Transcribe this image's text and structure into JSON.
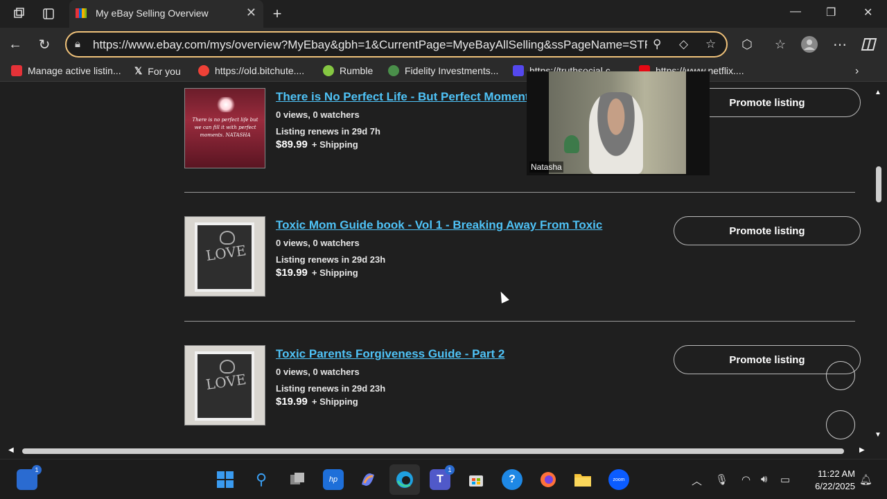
{
  "browser": {
    "tab_title": "My eBay Selling Overview",
    "url": "https://www.ebay.com/mys/overview?MyEbay&gbh=1&CurrentPage=MyeBayAllSelling&ssPageName=STRK...",
    "new_tab_label": "+"
  },
  "bookmarks": [
    {
      "label": "Manage active listin...",
      "icon": "ebay-icon",
      "color": "#e53238"
    },
    {
      "label": "For you",
      "icon": "x-icon",
      "color": "#000000"
    },
    {
      "label": "https://old.bitchute....",
      "icon": "bitchute-icon",
      "color": "#ef4137"
    },
    {
      "label": "Rumble",
      "icon": "rumble-icon",
      "color": "#85c742"
    },
    {
      "label": "Fidelity Investments...",
      "icon": "fidelity-icon",
      "color": "#4a8f4a"
    },
    {
      "label": "https://truthsocial.c...",
      "icon": "truthsocial-icon",
      "color": "#5448ee"
    },
    {
      "label": "https://www.netflix....",
      "icon": "netflix-icon",
      "color": "#e50914"
    }
  ],
  "listings": [
    {
      "title": "There is No Perfect Life - But Perfect Moment",
      "stats": "0 views, 0 watchers",
      "renews": "Listing renews in 29d 7h",
      "price": "$89.99",
      "shipping": "+ Shipping",
      "promote_label": "Promote listing",
      "thumb_text": "There is no perfect life but we can fill it with perfect moments. NATASHA"
    },
    {
      "title": "Toxic Mom Guide book - Vol 1 - Breaking Away From Toxic",
      "stats": "0 views, 0 watchers",
      "renews": "Listing renews in 29d 23h",
      "price": "$19.99",
      "shipping": "+ Shipping",
      "promote_label": "Promote listing",
      "thumb_text": "LOVE"
    },
    {
      "title": "Toxic Parents Forgiveness Guide - Part 2",
      "stats": "0 views, 0 watchers",
      "renews": "Listing renews in 29d 23h",
      "price": "$19.99",
      "shipping": "+ Shipping",
      "promote_label": "Promote listing",
      "thumb_text": "LOVE"
    }
  ],
  "video_overlay": {
    "participant_name": "Natasha"
  },
  "taskbar": {
    "time": "11:22 AM",
    "date": "6/22/2025",
    "widgets_badge": "1",
    "teams_badge": "1"
  },
  "colors": {
    "link": "#4fc3f7",
    "address_border": "#f0c27a",
    "background": "#1f1f1f"
  }
}
